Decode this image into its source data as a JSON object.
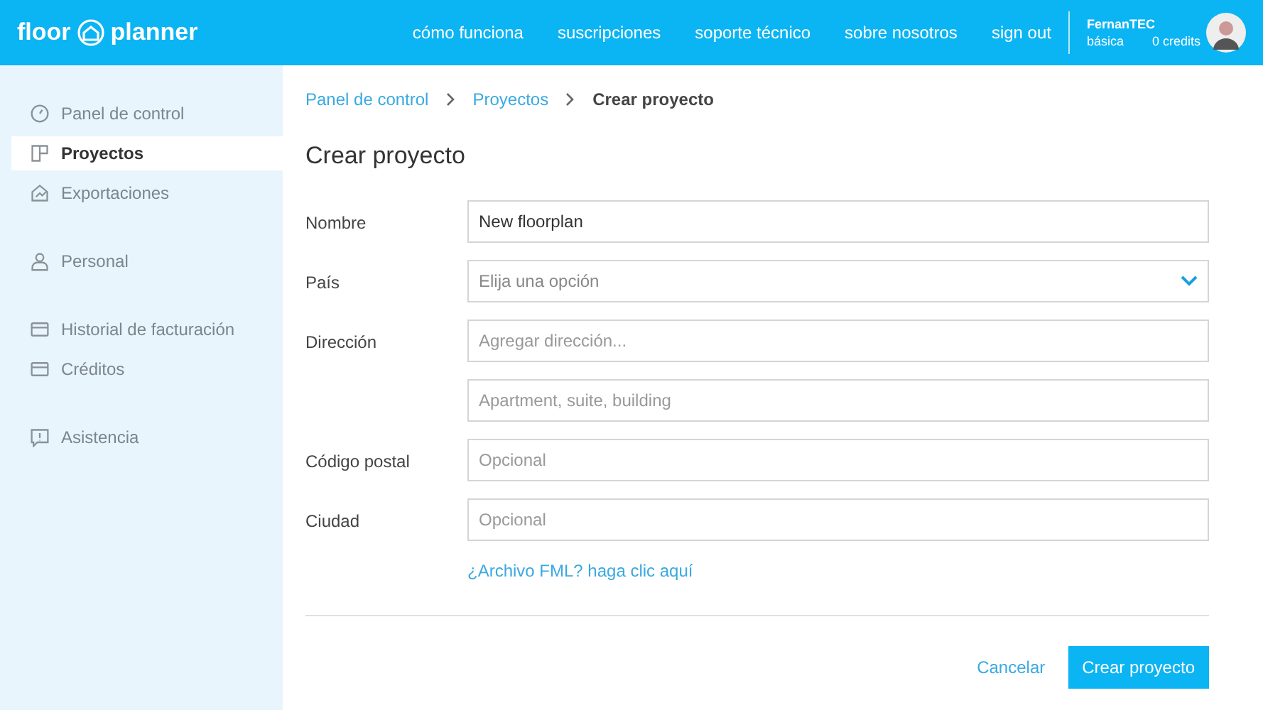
{
  "header": {
    "logo_left": "floor",
    "logo_right": "planner",
    "nav": [
      "cómo funciona",
      "suscripciones",
      "soporte técnico",
      "sobre nosotros",
      "sign out"
    ],
    "user": {
      "name": "FernanTEC",
      "plan": "básica",
      "credits": "0 credits"
    }
  },
  "sidebar": {
    "groups": [
      [
        {
          "label": "Panel de control",
          "kind": "dashboard",
          "selected": false
        },
        {
          "label": "Proyectos",
          "kind": "projects",
          "selected": true
        },
        {
          "label": "Exportaciones",
          "kind": "export",
          "selected": false
        }
      ],
      [
        {
          "label": "Personal",
          "kind": "person",
          "selected": false
        }
      ],
      [
        {
          "label": "Historial de facturación",
          "kind": "card",
          "selected": false
        },
        {
          "label": "Créditos",
          "kind": "card",
          "selected": false
        }
      ],
      [
        {
          "label": "Asistencia",
          "kind": "help",
          "selected": false
        }
      ]
    ]
  },
  "breadcrumb": [
    {
      "label": "Panel de control",
      "current": false
    },
    {
      "label": "Proyectos",
      "current": false
    },
    {
      "label": "Crear proyecto",
      "current": true
    }
  ],
  "title": "Crear proyecto",
  "form": [
    {
      "label": "Nombre",
      "kind": "text",
      "value": "New floorplan"
    },
    {
      "label": "País",
      "kind": "select",
      "placeholder": "Elija una opción"
    },
    {
      "label": "Dirección",
      "kind": "text",
      "placeholder": "Agregar dirección..."
    },
    {
      "kind": "text",
      "placeholder": "Apartment, suite, building"
    },
    {
      "label": "Código postal",
      "kind": "text",
      "placeholder": "Opcional"
    },
    {
      "label": "Ciudad",
      "kind": "text",
      "placeholder": "Opcional"
    }
  ],
  "fml_link": "¿Archivo FML? haga clic aquí",
  "buttons": {
    "cancel": "Cancelar",
    "submit": "Crear proyecto"
  }
}
